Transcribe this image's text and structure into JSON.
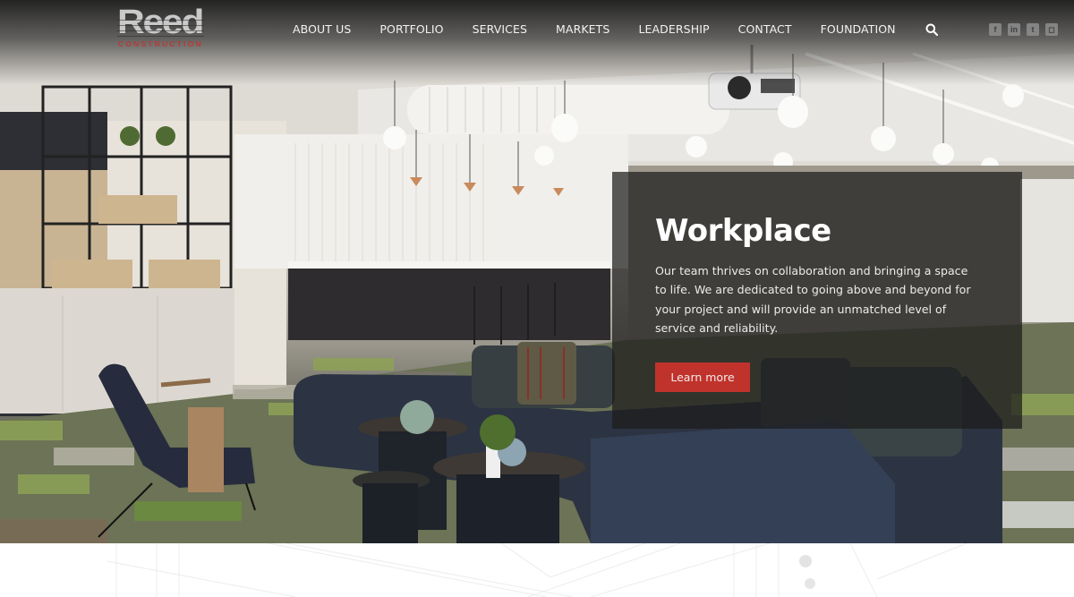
{
  "brand": {
    "name": "Reed",
    "tagline": "CONSTRUCTION",
    "colors": {
      "logo_gray": "#c9c9c9",
      "logo_red": "#b83a36",
      "accent_red": "#c0332c"
    }
  },
  "nav": {
    "items": [
      {
        "label": "ABOUT US"
      },
      {
        "label": "PORTFOLIO"
      },
      {
        "label": "SERVICES"
      },
      {
        "label": "MARKETS"
      },
      {
        "label": "LEADERSHIP"
      },
      {
        "label": "CONTACT"
      },
      {
        "label": "FOUNDATION"
      }
    ],
    "search_icon": "search-icon"
  },
  "social": [
    {
      "name": "facebook",
      "glyph": "f"
    },
    {
      "name": "linkedin",
      "glyph": "in"
    },
    {
      "name": "twitter",
      "glyph": "t"
    },
    {
      "name": "instagram",
      "glyph": "◻"
    }
  ],
  "hero": {
    "image_description": "Modern open office lounge with kitchen, pendant lights, projector, patterned green carpet and navy sofas",
    "title": "Workplace",
    "body": "Our team thrives on collaboration and bringing a space to life. We are dedicated to going above and beyond for your project and will provide an unmatched level of service and reliability.",
    "cta_label": "Learn more"
  }
}
